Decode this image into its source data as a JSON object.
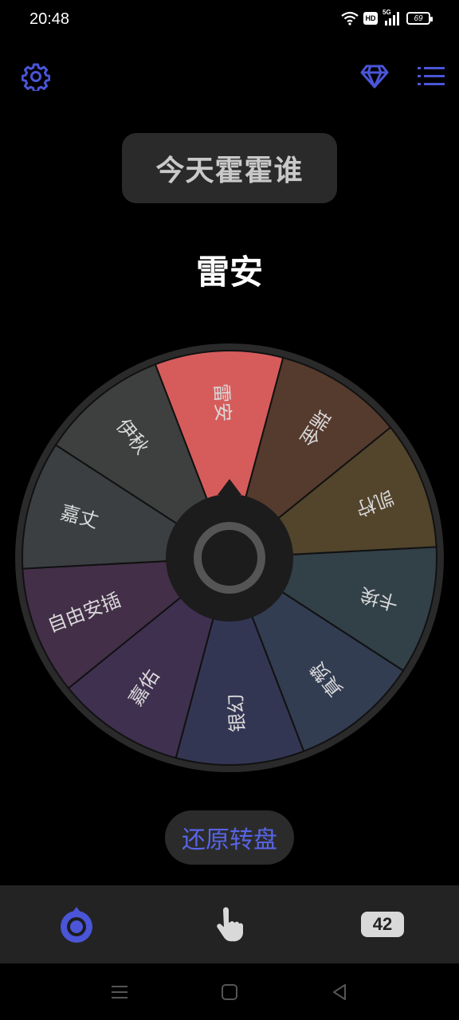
{
  "status_bar": {
    "time": "20:48",
    "network": "5G",
    "hd": "HD",
    "battery": "69"
  },
  "header": {
    "settings_icon": "gear-icon",
    "premium_icon": "diamond-icon",
    "list_icon": "list-icon"
  },
  "title": "今天霍霍谁",
  "result": "雷安",
  "wheel": {
    "segments": [
      {
        "label": "雷安",
        "color": "#d65c5c"
      },
      {
        "label": "瑞金",
        "color": "#553a2e"
      },
      {
        "label": "凯柠",
        "color": "#52452c"
      },
      {
        "label": "卡埃",
        "color": "#324048"
      },
      {
        "label": "真赞",
        "color": "#323d52"
      },
      {
        "label": "银幻",
        "color": "#333653"
      },
      {
        "label": "嘉佑",
        "color": "#3f3050"
      },
      {
        "label": "自由安插",
        "color": "#432f48"
      },
      {
        "label": "嘉丈",
        "color": "#3b3f42"
      },
      {
        "label": "伊秋",
        "color": "#3d403e"
      }
    ],
    "center_icon": "spin-knob-icon"
  },
  "reset_button": "还原转盘",
  "bottom_nav": {
    "items": [
      {
        "name": "wheel",
        "icon": "wheel-target-icon",
        "active": true
      },
      {
        "name": "touch",
        "icon": "hand-pointer-icon",
        "active": false
      },
      {
        "name": "count",
        "value": "42",
        "active": false
      }
    ],
    "accent": "#4a55d8"
  },
  "system_nav": {
    "menu": "menu-icon",
    "home": "home-icon",
    "back": "back-icon"
  }
}
